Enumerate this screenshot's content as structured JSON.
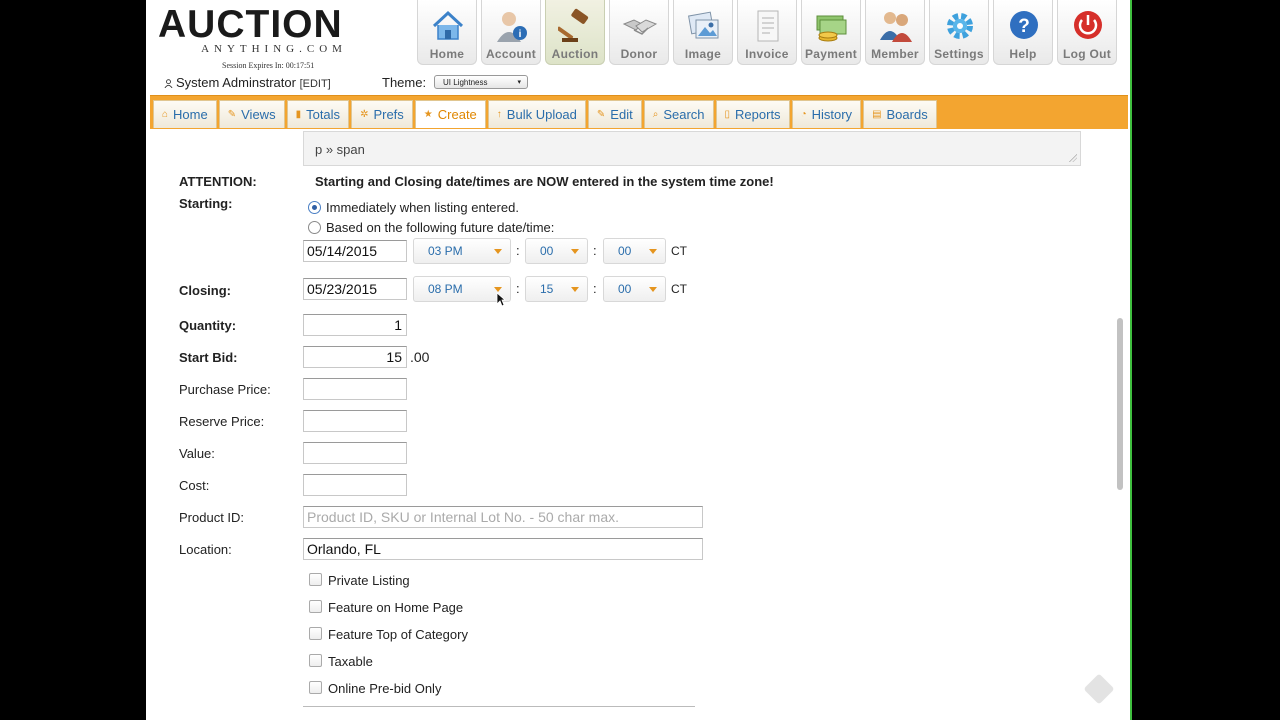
{
  "logo": {
    "main": "AUCTION",
    "sub": "ANYTHING.COM"
  },
  "session": "Session Expires In: 00:17:51",
  "user": {
    "name": "System Adminstrator",
    "edit": "[EDIT]"
  },
  "theme": {
    "label": "Theme:",
    "value": "UI Lightness"
  },
  "top_icons": [
    {
      "label": "Home",
      "icon": "home-icon"
    },
    {
      "label": "Account",
      "icon": "account-icon"
    },
    {
      "label": "Auction",
      "icon": "gavel-icon",
      "active": true
    },
    {
      "label": "Donor",
      "icon": "handshake-icon"
    },
    {
      "label": "Image",
      "icon": "image-icon"
    },
    {
      "label": "Invoice",
      "icon": "invoice-icon"
    },
    {
      "label": "Payment",
      "icon": "money-icon"
    },
    {
      "label": "Member",
      "icon": "members-icon"
    },
    {
      "label": "Settings",
      "icon": "gear-icon"
    },
    {
      "label": "Help",
      "icon": "help-icon"
    },
    {
      "label": "Log Out",
      "icon": "power-icon"
    }
  ],
  "nav_tabs": [
    {
      "label": "Home",
      "glyph": "⌂"
    },
    {
      "label": "Views",
      "glyph": "✎"
    },
    {
      "label": "Totals",
      "glyph": "▮"
    },
    {
      "label": "Prefs",
      "glyph": "✲"
    },
    {
      "label": "Create",
      "glyph": "★",
      "active": true
    },
    {
      "label": "Bulk Upload",
      "glyph": "↑"
    },
    {
      "label": "Edit",
      "glyph": "✎"
    },
    {
      "label": "Search",
      "glyph": "⌕"
    },
    {
      "label": "Reports",
      "glyph": "▯"
    },
    {
      "label": "History",
      "glyph": "◔"
    },
    {
      "label": "Boards",
      "glyph": "▤"
    }
  ],
  "editor_path": "p » span",
  "attention": {
    "label": "ATTENTION:",
    "text": "Starting and Closing date/times are NOW entered in the system time zone!"
  },
  "starting": {
    "label": "Starting:",
    "option_now": "Immediately when listing entered.",
    "option_future": "Based on the following future date/time:",
    "selected": "now",
    "date": "05/14/2015",
    "hour": "03 PM",
    "minute": "00",
    "second": "00",
    "tz": "CT"
  },
  "closing": {
    "label": "Closing:",
    "date": "05/23/2015",
    "hour": "08 PM",
    "minute": "15",
    "second": "00",
    "tz": "CT"
  },
  "fields": {
    "quantity": {
      "label": "Quantity:",
      "value": "1"
    },
    "start_bid": {
      "label": "Start Bid:",
      "value": "15",
      "cents": ".00"
    },
    "purchase_price": {
      "label": "Purchase Price:",
      "value": ""
    },
    "reserve_price": {
      "label": "Reserve Price:",
      "value": ""
    },
    "value": {
      "label": "Value:",
      "value": ""
    },
    "cost": {
      "label": "Cost:",
      "value": ""
    },
    "product_id": {
      "label": "Product ID:",
      "placeholder": "Product ID, SKU or Internal Lot No. - 50 char max."
    },
    "location": {
      "label": "Location:",
      "value": "Orlando, FL"
    }
  },
  "checkboxes": [
    {
      "label": "Private Listing",
      "checked": false
    },
    {
      "label": "Feature on Home Page",
      "checked": false
    },
    {
      "label": "Feature Top of Category",
      "checked": false
    },
    {
      "label": "Taxable",
      "checked": false
    },
    {
      "label": "Online Pre-bid Only",
      "checked": false
    }
  ],
  "colors": {
    "nav_orange": "#f3a530",
    "tab_text": "#2a6dab",
    "active_tab_text": "#e08700",
    "accent": "#e5951f"
  }
}
